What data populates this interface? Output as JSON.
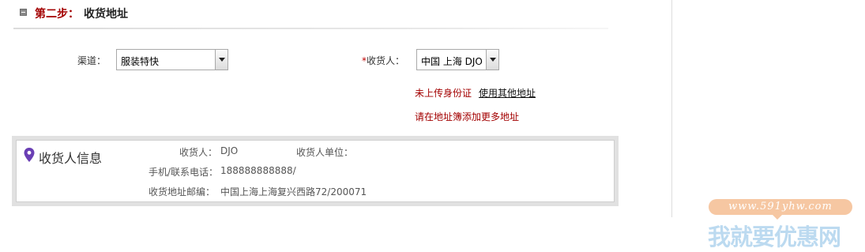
{
  "step": {
    "number_label": "第二步：",
    "title": "收货地址"
  },
  "form": {
    "channel": {
      "label": "渠道：",
      "value": "服装特快"
    },
    "receiver": {
      "required_mark": "*",
      "label": "收货人：",
      "value": "中国 上海 DJO",
      "id_warning": "未上传身份证",
      "use_other_address": "使用其他地址",
      "add_more_hint": "请在地址簿添加更多地址"
    }
  },
  "receiver_info": {
    "title": "收货人信息",
    "name_label": "收货人：",
    "name_value": "DJO",
    "unit_label": "收货人单位：",
    "unit_value": "",
    "phone_label": "手机/联系电话：",
    "phone_value": "188888888888/",
    "address_label": "收货地址邮编：",
    "address_value": "中国上海上海复兴西路72/200071"
  },
  "watermark": {
    "url_text": "www.591yhw.com",
    "brand_text": "我就要优惠网"
  },
  "colors": {
    "accent_red": "#a30000",
    "pin_purple": "#6a3fb4",
    "watermark_orange": "#f6c7a2",
    "watermark_blue": "#bcdaf0"
  }
}
